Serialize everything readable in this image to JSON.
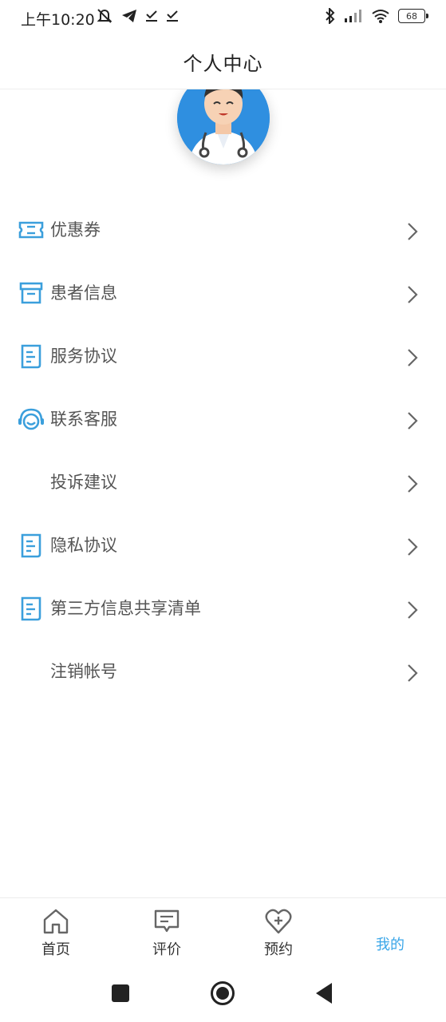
{
  "status_bar": {
    "time": "上午10:20",
    "battery": "68"
  },
  "header": {
    "title": "个人中心"
  },
  "menu": {
    "items": [
      {
        "label": "优惠券",
        "icon": "coupon-icon"
      },
      {
        "label": "患者信息",
        "icon": "archive-box-icon"
      },
      {
        "label": "服务协议",
        "icon": "document-icon"
      },
      {
        "label": "联系客服",
        "icon": "headset-icon"
      },
      {
        "label": "投诉建议",
        "icon": ""
      },
      {
        "label": "隐私协议",
        "icon": "document-icon"
      },
      {
        "label": "第三方信息共享清单",
        "icon": "document-icon"
      },
      {
        "label": "注销帐号",
        "icon": ""
      }
    ]
  },
  "bottom_nav": {
    "items": [
      {
        "label": "首页",
        "icon": "home-icon"
      },
      {
        "label": "评价",
        "icon": "comment-icon"
      },
      {
        "label": "预约",
        "icon": "heart-plus-icon"
      },
      {
        "label": "我的",
        "icon": "",
        "active": true
      }
    ]
  },
  "colors": {
    "accent": "#3aa6e8",
    "icon": "#3b9fdc",
    "text": "#555555",
    "chevron": "#666666"
  }
}
